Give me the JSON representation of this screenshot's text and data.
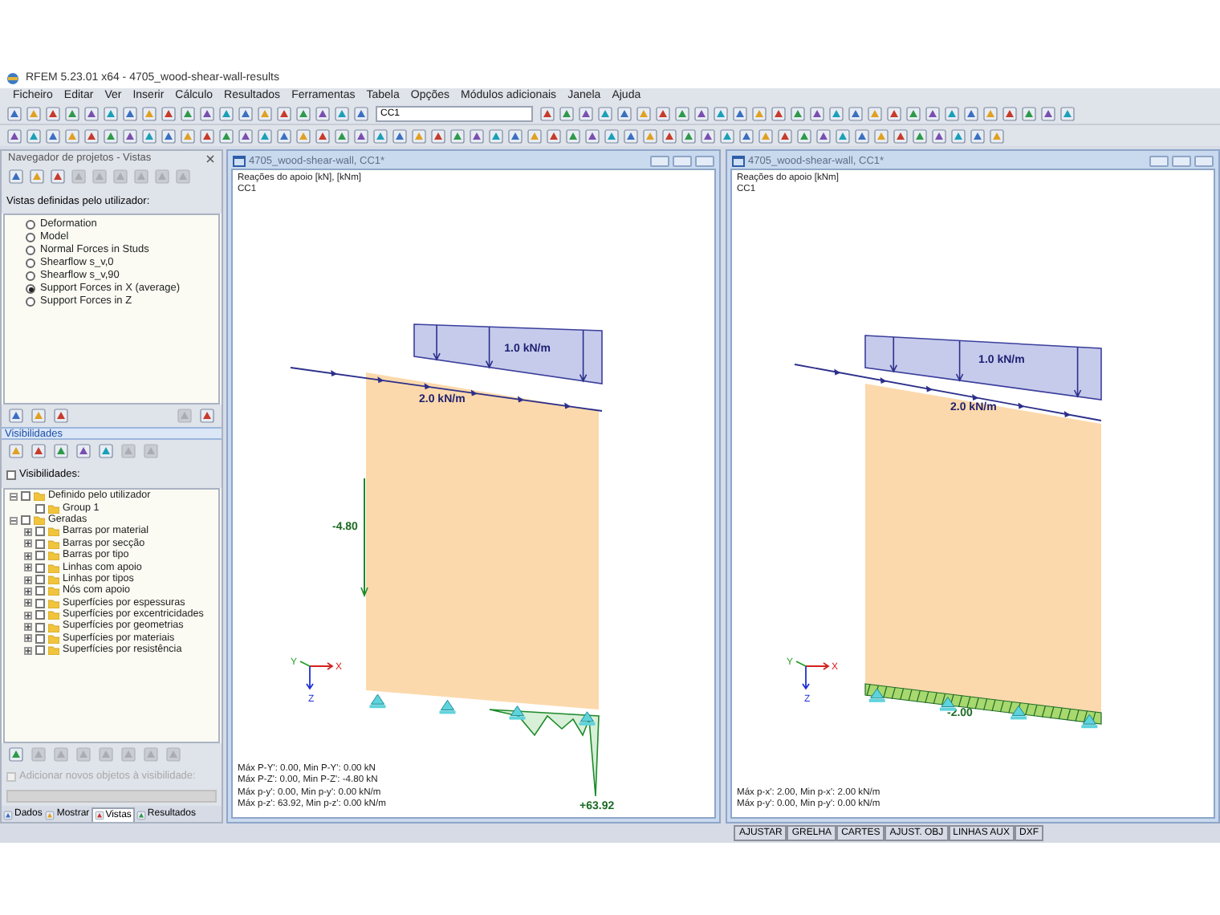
{
  "window": {
    "title": "RFEM 5.23.01 x64 - 4705_wood-shear-wall-results"
  },
  "menu": [
    "Ficheiro",
    "Editar",
    "Ver",
    "Inserir",
    "Cálculo",
    "Resultados",
    "Ferramentas",
    "Tabela",
    "Opções",
    "Módulos adicionais",
    "Janela",
    "Ajuda"
  ],
  "toolbar": {
    "load_case": "CC1"
  },
  "navigator": {
    "title": "Navegador de projetos - Vistas",
    "views_label": "Vistas definidas pelo utilizador:",
    "views": [
      {
        "label": "Deformation",
        "selected": false
      },
      {
        "label": "Model",
        "selected": false
      },
      {
        "label": "Normal Forces in Studs",
        "selected": false
      },
      {
        "label": "Shearflow s_v,0",
        "selected": false
      },
      {
        "label": "Shearflow s_v,90",
        "selected": false
      },
      {
        "label": "Support Forces in X (average)",
        "selected": true
      },
      {
        "label": "Support Forces in Z",
        "selected": false
      }
    ],
    "visibility_title": "Visibilidades",
    "visibility_checkbox": {
      "label": "Visibilidades:",
      "checked": false
    },
    "tree": [
      {
        "label": "Definido pelo utilizador",
        "checked": false,
        "expanded": true,
        "children": [
          {
            "label": "Group 1",
            "checked": false
          }
        ]
      },
      {
        "label": "Geradas",
        "checked": false,
        "expanded": true,
        "children": [
          {
            "label": "Barras por material",
            "checked": false,
            "expanded": false
          },
          {
            "label": "Barras por secção",
            "checked": false,
            "expanded": false
          },
          {
            "label": "Barras por tipo",
            "checked": false,
            "expanded": false
          },
          {
            "label": "Linhas com apoio",
            "checked": false,
            "expanded": false
          },
          {
            "label": "Linhas por tipos",
            "checked": false,
            "expanded": false
          },
          {
            "label": "Nós com apoio",
            "checked": false,
            "expanded": false
          },
          {
            "label": "Superfícies por espessuras",
            "checked": false,
            "expanded": false
          },
          {
            "label": "Superfícies por excentricidades",
            "checked": false,
            "expanded": false
          },
          {
            "label": "Superfícies por geometrias",
            "checked": false,
            "expanded": false
          },
          {
            "label": "Superfícies por materiais",
            "checked": false,
            "expanded": false
          },
          {
            "label": "Superfícies por resistência",
            "checked": false,
            "expanded": false
          }
        ]
      }
    ],
    "add_checkbox": {
      "label": "Adicionar novos objetos à visibilidade:",
      "checked": false,
      "disabled": true
    },
    "tabs": [
      {
        "label": "Dados",
        "selected": false
      },
      {
        "label": "Mostrar",
        "selected": false
      },
      {
        "label": "Vistas",
        "selected": true
      },
      {
        "label": "Resultados",
        "selected": false
      }
    ]
  },
  "views": [
    {
      "title": "4705_wood-shear-wall, CC1*",
      "kind": "vertical-reactions",
      "header": [
        "Reações do apoio [kN], [kNm]",
        "CC1"
      ],
      "distributed_load": "1.0 kN/m",
      "line_load": "2.0 kN/m",
      "results": [
        "-4.80",
        "+63.92"
      ],
      "axis_labels": [
        "Y",
        "X",
        "Z"
      ],
      "summary": [
        "Máx P-Y': 0.00, Min P-Y': 0.00 kN",
        "Máx P-Z': 0.00, Min P-Z': -4.80 kN",
        "Máx p-y': 0.00, Min p-y': 0.00 kN/m",
        "Máx p-z': 63.92, Min p-z': 0.00 kN/m"
      ]
    },
    {
      "title": "4705_wood-shear-wall, CC1*",
      "kind": "horizontal-reactions",
      "header": [
        "Reações do apoio [kNm]",
        "CC1"
      ],
      "distributed_load": "1.0 kN/m",
      "line_load": "2.0 kN/m",
      "results": [
        "-2.00"
      ],
      "axis_labels": [
        "Y",
        "X",
        "Z"
      ],
      "summary": [
        "Máx p-x': 2.00, Min p-x': 2.00 kN/m",
        "Máx p-y': 0.00, Min p-y': 0.00 kN/m"
      ]
    }
  ],
  "status_bar": [
    "AJUSTAR",
    "GRELHA",
    "CARTES",
    "AJUST. OBJ",
    "LINHAS AUX",
    "DXF"
  ]
}
